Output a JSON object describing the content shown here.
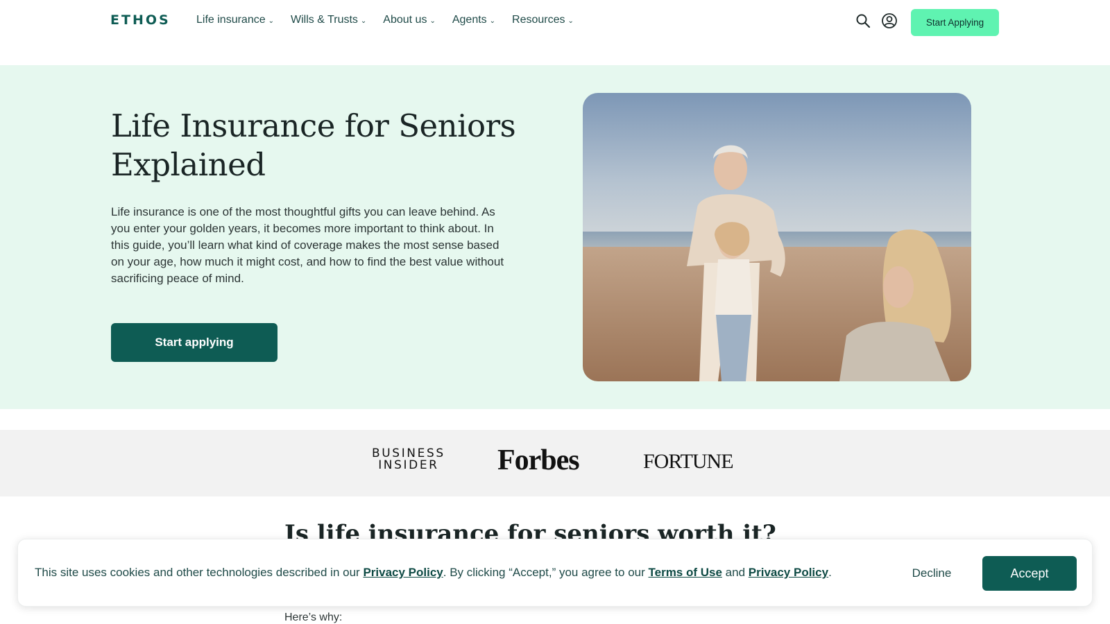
{
  "header": {
    "logo": "ETHOS",
    "nav": [
      {
        "label": "Life insurance"
      },
      {
        "label": "Wills & Trusts"
      },
      {
        "label": "About us"
      },
      {
        "label": "Agents"
      },
      {
        "label": "Resources"
      }
    ],
    "cta_label": "Start Applying",
    "icons": {
      "search": "search-icon",
      "account": "user-circle-icon",
      "dropdown": "chevron-down-icon"
    }
  },
  "hero": {
    "title_line1": "Life Insurance for Seniors",
    "title_line2": "Explained",
    "description": "Life insurance is one of the most thoughtful gifts you can leave behind. As you enter your golden years, it becomes more important to think about. In this guide, you’ll learn what kind of coverage makes the most sense based on your age, how much it might cost, and how to find the best value without sacrificing peace of mind.",
    "cta_label": "Start applying",
    "background_color": "#e6f8ef"
  },
  "press": {
    "logos": [
      {
        "line1": "BUSINESS",
        "line2": "INSIDER"
      },
      {
        "name": "Forbes"
      },
      {
        "name": "FORTUNE"
      }
    ]
  },
  "article": {
    "heading": "Is life insurance for seniors worth it?",
    "subheading": "Here’s why:"
  },
  "cookie_banner": {
    "text_part1": "This site uses cookies and other technologies described in our ",
    "link_privacy_1": "Privacy Policy",
    "text_part2": ". By clicking “Accept,” you agree to our ",
    "link_terms": "Terms of Use",
    "text_part3": " and ",
    "link_privacy_2": "Privacy Policy",
    "text_part4": ".",
    "decline_label": "Decline",
    "accept_label": "Accept"
  },
  "colors": {
    "brand_dark": "#0e5c54",
    "brand_mint": "#5ff3b1",
    "hero_bg": "#e6f8ef",
    "press_bg": "#f2f2f2"
  }
}
